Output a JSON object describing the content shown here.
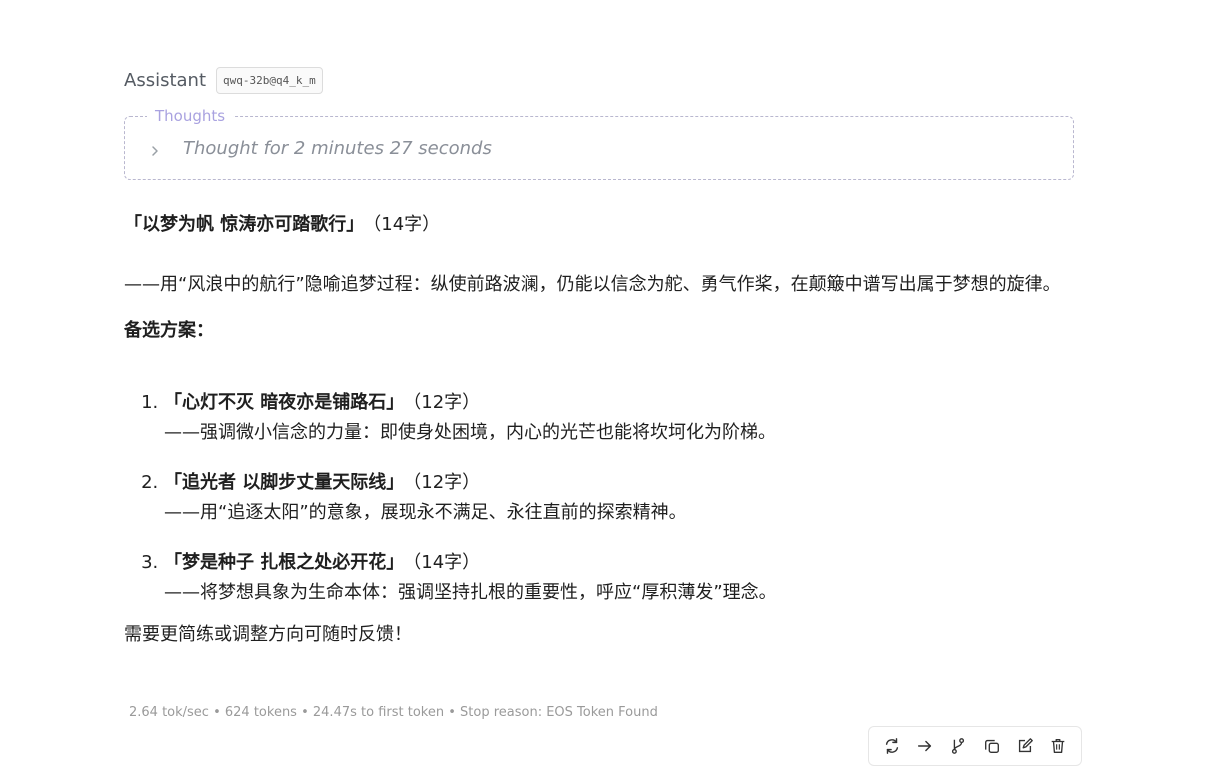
{
  "message": {
    "role": "Assistant",
    "model": "qwq-32b@q4_k_m",
    "thoughts": {
      "legend": "Thoughts",
      "summary": "Thought for 2 minutes 27 seconds"
    },
    "main_title": "「以梦为帆 惊涛亦可踏歌行」",
    "main_title_count": "（14字）",
    "main_desc": "——用“风浪中的航行”隐喻追梦过程：纵使前路波澜，仍能以信念为舵、勇气作桨，在颠簸中谱写出属于梦想的旋律。",
    "alt_heading": "备选方案：",
    "alternatives": [
      {
        "name": "「心灯不灭 暗夜亦是铺路石」",
        "count": "（12字）",
        "desc": "——强调微小信念的力量：即使身处困境，内心的光芒也能将坎坷化为阶梯。"
      },
      {
        "name": "「追光者 以脚步丈量天际线」",
        "count": "（12字）",
        "desc": "——用“追逐太阳”的意象，展现永不满足、永往直前的探索精神。"
      },
      {
        "name": "「梦是种子 扎根之处必开花」",
        "count": "（14字）",
        "desc": "——将梦想具象为生命本体：强调坚持扎根的重要性，呼应“厚积薄发”理念。"
      }
    ],
    "closing": "需要更简练或调整方向可随时反馈！",
    "stats": "2.64 tok/sec • 624 tokens • 24.47s to first token • Stop reason: EOS Token Found"
  },
  "toolbar": {
    "icons": [
      "regenerate-icon",
      "continue-icon",
      "branch-icon",
      "copy-icon",
      "edit-icon",
      "delete-icon"
    ]
  }
}
